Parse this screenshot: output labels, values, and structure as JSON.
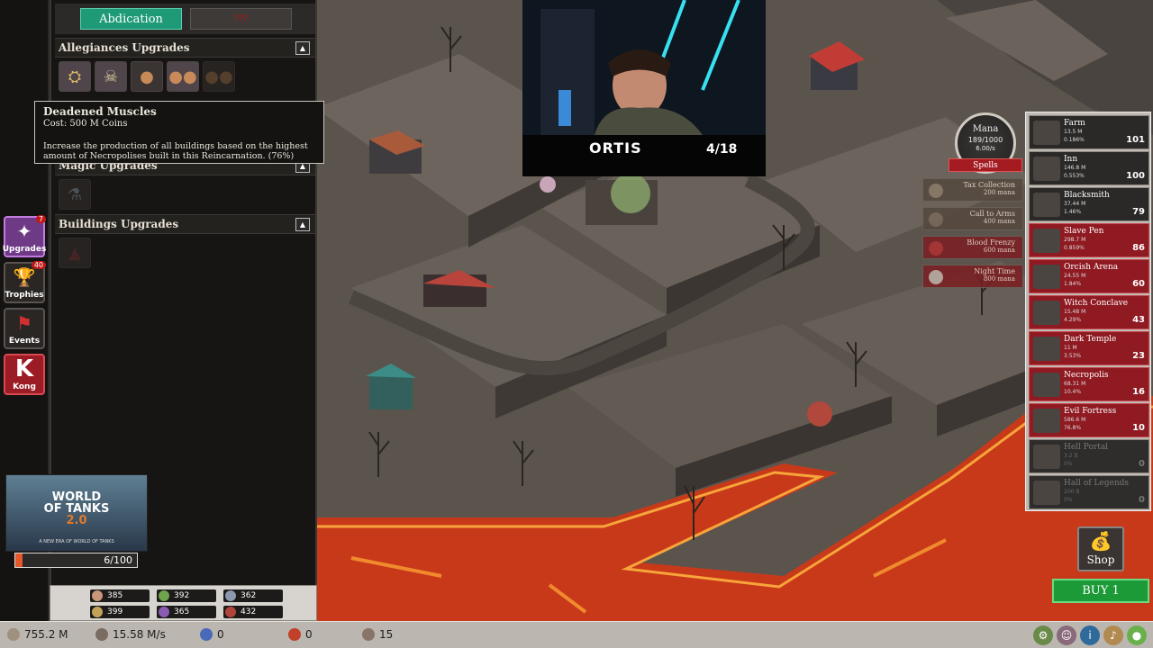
{
  "panel": {
    "tab_abdication": "Abdication",
    "tab_other": "???",
    "sections": {
      "allegiances": "Allegiances Upgrades",
      "magic": "Magic Upgrades",
      "buildings": "Buildings Upgrades"
    },
    "toggle_glyph": "▲"
  },
  "tooltip": {
    "title": "Deadened Muscles",
    "cost": "Cost: 500 M Coins",
    "description": "Increase the production of all buildings based on the highest amount of Necropolises built in this Reincarnation. (76%)"
  },
  "rail": {
    "upgrades": {
      "label": "Upgrades",
      "badge": "7"
    },
    "trophies": {
      "label": "Trophies",
      "badge": "40"
    },
    "events": {
      "label": "Events"
    },
    "kong": {
      "label": "Kong",
      "glyph": "K"
    }
  },
  "ad": {
    "logo_line1": "WORLD",
    "logo_line2": "OF TANKS",
    "logo_line3": "2.0",
    "tagline": "A NEW ERA OF WORLD OF TANKS"
  },
  "progress": {
    "text": "6/100",
    "fraction": 0.06
  },
  "resources": [
    {
      "value": "385",
      "color": "#c9967a"
    },
    {
      "value": "392",
      "color": "#6fa34c"
    },
    {
      "value": "362",
      "color": "#8b99b0"
    },
    {
      "value": "399",
      "color": "#c2a35a"
    },
    {
      "value": "365",
      "color": "#8a5cb3"
    },
    {
      "value": "432",
      "color": "#b1453a"
    }
  ],
  "webcam": {
    "name": "ORTIS",
    "sub": "4/18"
  },
  "mana": {
    "title": "Mana",
    "value": "189/1000",
    "rate": "6.00/s",
    "spells_label": "Spells"
  },
  "spells": [
    {
      "name": "Tax Collection",
      "cost": "200 mana",
      "bg": "#54483e"
    },
    {
      "name": "Call to Arms",
      "cost": "400 mana",
      "bg": "#54483e"
    },
    {
      "name": "Blood Frenzy",
      "cost": "600 mana",
      "bg": "#7b1e22"
    },
    {
      "name": "Night Time",
      "cost": "800 mana",
      "bg": "#7b1e22"
    }
  ],
  "buildings": [
    {
      "name": "Farm",
      "line1": "13.5 M",
      "line2": "0.186%",
      "count": "101",
      "style": "plain"
    },
    {
      "name": "Inn",
      "line1": "146.8 M",
      "line2": "0.553%",
      "count": "100",
      "style": "plain"
    },
    {
      "name": "Blacksmith",
      "line1": "37.44 M",
      "line2": "1.46%",
      "count": "79",
      "style": "plain"
    },
    {
      "name": "Slave Pen",
      "line1": "298.7 M",
      "line2": "0.859%",
      "count": "86",
      "style": "red"
    },
    {
      "name": "Orcish Arena",
      "line1": "24.55 M",
      "line2": "1.84%",
      "count": "60",
      "style": "red"
    },
    {
      "name": "Witch Conclave",
      "line1": "15.48 M",
      "line2": "4.29%",
      "count": "43",
      "style": "red"
    },
    {
      "name": "Dark Temple",
      "line1": "11 M",
      "line2": "3.53%",
      "count": "23",
      "style": "red"
    },
    {
      "name": "Necropolis",
      "line1": "68.31 M",
      "line2": "10.4%",
      "count": "16",
      "style": "red"
    },
    {
      "name": "Evil Fortress",
      "line1": "586.6 M",
      "line2": "76.8%",
      "count": "10",
      "style": "red"
    },
    {
      "name": "Hell Portal",
      "line1": "3.2 B",
      "line2": "0%",
      "count": "0",
      "style": "locked"
    },
    {
      "name": "Hall of Legends",
      "line1": "200 B",
      "line2": "0%",
      "count": "0",
      "style": "locked"
    }
  ],
  "shop_label": "Shop",
  "buy_label": "BUY 1",
  "bottom": {
    "coins": "755.2 M",
    "rate": "15.58 M/s",
    "gems": "0",
    "rubies": "0",
    "skulls": "15"
  },
  "colors": {
    "accent_green": "#1f9a78",
    "danger_red": "#8f1a22",
    "lava": "#d8401a"
  }
}
